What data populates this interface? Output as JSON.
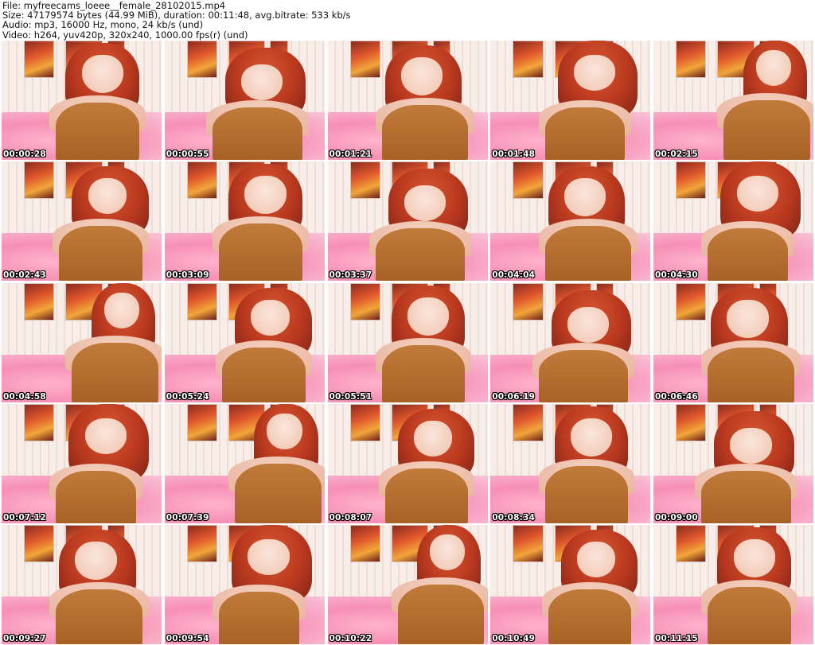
{
  "header": {
    "line1": "File: myfreecams_loeee__female_28102015.mp4",
    "line2": "Size: 47179574 bytes (44.99 MiB), duration: 00:11:48, avg.bitrate: 533 kb/s",
    "line3": "Audio: mp3, 16000 Hz, mono, 24 kb/s (und)",
    "line4": "Video: h264, yuv420p, 320x240, 1000.00 fps(r) (und)"
  },
  "thumbnails": [
    {
      "timestamp": "00:00:28"
    },
    {
      "timestamp": "00:00:55"
    },
    {
      "timestamp": "00:01:21"
    },
    {
      "timestamp": "00:01:48"
    },
    {
      "timestamp": "00:02:15"
    },
    {
      "timestamp": "00:02:43"
    },
    {
      "timestamp": "00:03:09"
    },
    {
      "timestamp": "00:03:37"
    },
    {
      "timestamp": "00:04:04"
    },
    {
      "timestamp": "00:04:30"
    },
    {
      "timestamp": "00:04:58"
    },
    {
      "timestamp": "00:05:24"
    },
    {
      "timestamp": "00:05:51"
    },
    {
      "timestamp": "00:06:19"
    },
    {
      "timestamp": "00:06:46"
    },
    {
      "timestamp": "00:07:12"
    },
    {
      "timestamp": "00:07:39"
    },
    {
      "timestamp": "00:08:07"
    },
    {
      "timestamp": "00:08:34"
    },
    {
      "timestamp": "00:09:00"
    },
    {
      "timestamp": "00:09:27"
    },
    {
      "timestamp": "00:09:54"
    },
    {
      "timestamp": "00:10:22"
    },
    {
      "timestamp": "00:10:49"
    },
    {
      "timestamp": "00:11:15"
    }
  ]
}
